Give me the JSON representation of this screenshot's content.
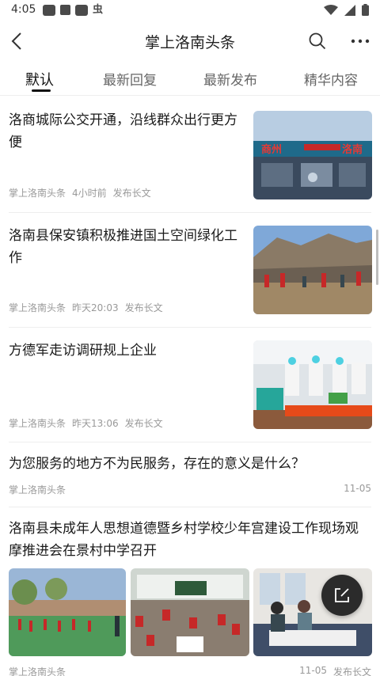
{
  "status_bar": {
    "time": "4:05",
    "icons": [
      "wechat-icon",
      "a-icon",
      "wechat-icon",
      "bug-icon"
    ],
    "right_icons": [
      "wifi-icon",
      "signal-icon",
      "battery-icon"
    ]
  },
  "header": {
    "title": "掌上洛南头条"
  },
  "tabs": [
    {
      "label": "默认",
      "active": true
    },
    {
      "label": "最新回复",
      "active": false
    },
    {
      "label": "最新发布",
      "active": false
    },
    {
      "label": "精华内容",
      "active": false
    }
  ],
  "feed": [
    {
      "title": "洛商城际公交开通，沿线群众出行更方便",
      "author": "掌上洛南头条",
      "time": "4小时前",
      "tag": "发布长文",
      "image": "bus-station-photo"
    },
    {
      "title": "洛南县保安镇积极推进国土空间绿化工作",
      "author": "掌上洛南头条",
      "time": "昨天20:03",
      "tag": "发布长文",
      "image": "tree-planting-photo"
    },
    {
      "title": "方德军走访调研规上企业",
      "author": "掌上洛南头条",
      "time": "昨天13:06",
      "tag": "发布长文",
      "image": "factory-workers-photo"
    },
    {
      "title": "为您服务的地方不为民服务，存在的意义是什么？",
      "author": "掌上洛南头条",
      "date": "11-05"
    },
    {
      "title": "洛南县未成年人思想道德暨乡村学校少年宫建设工作现场观摩推进会在景村中学召开",
      "author": "掌上洛南头条",
      "date": "11-05",
      "tag": "发布长文",
      "images": [
        "school-playground-photo",
        "classroom-photo",
        "exhibition-photo"
      ]
    }
  ],
  "fab": {
    "icon": "compose-icon"
  },
  "colors": {
    "accent": "#111111",
    "meta": "#999999",
    "divider": "#eeeeee"
  }
}
